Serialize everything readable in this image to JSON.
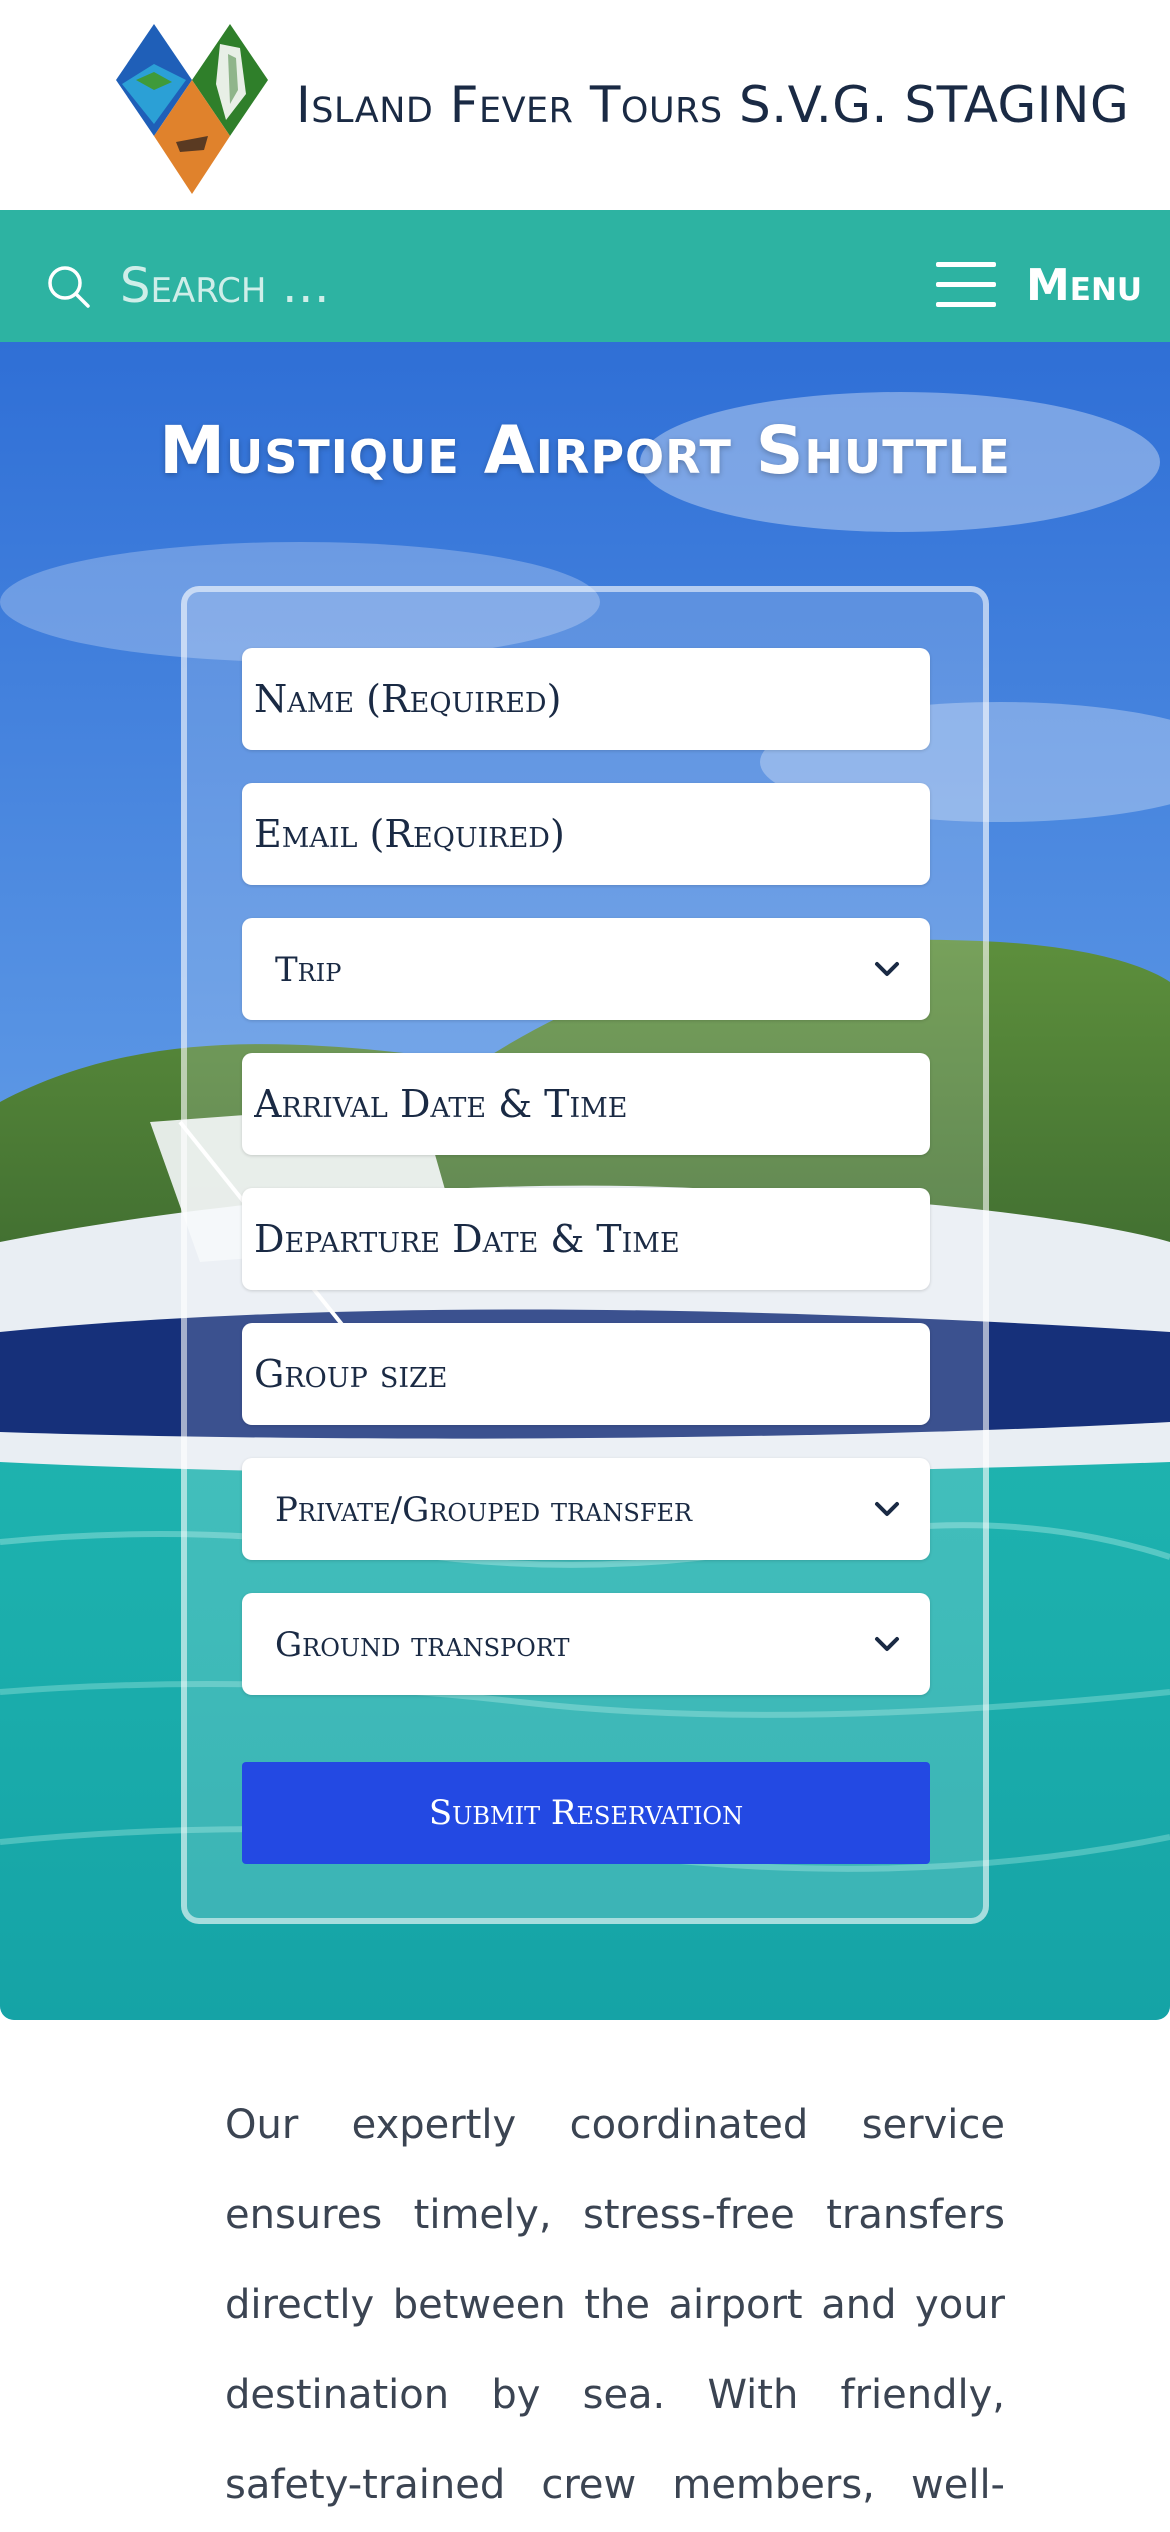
{
  "header": {
    "site_title": "Island Fever Tours S.V.G. STAGING"
  },
  "navbar": {
    "search_placeholder": "Search …",
    "menu_label": "Menu"
  },
  "hero": {
    "title": "Mustique Airport Shuttle"
  },
  "form": {
    "name_placeholder": "Name (Required)",
    "email_placeholder": "Email (Required)",
    "trip_selected": "Trip",
    "arrival_placeholder": "Arrival Date & Time",
    "departure_placeholder": "Departure Date & Time",
    "group_size_placeholder": "Group size",
    "transfer_selected": "Private/Grouped transfer",
    "ground_transport_selected": "Ground transport",
    "submit_label": "Submit Reservation"
  },
  "content": {
    "paragraph": "Our expertly coordinated service ensures timely, stress-free transfers directly between the airport and your destination by sea. With friendly, safety-trained crew members, well-maintained vessels, and a"
  },
  "colors": {
    "navbar": "#2db3a2",
    "submit": "#2349e3",
    "title_text": "#1a2a44"
  }
}
